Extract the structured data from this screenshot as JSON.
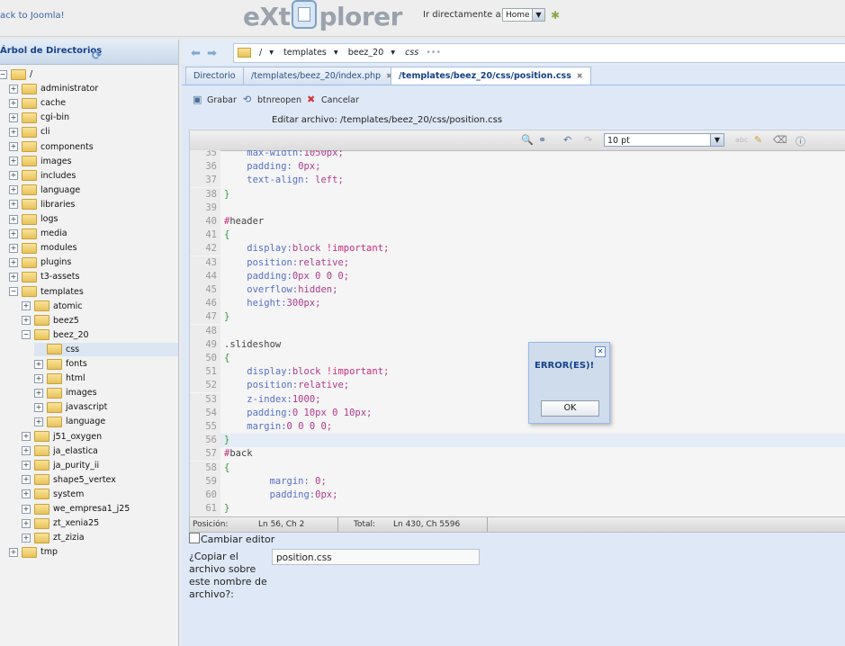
{
  "top": {
    "back_link": "ack to Joomla!",
    "logo_left": "eXt",
    "logo_right": "plorer",
    "goto_label": "Ir directamente a:",
    "goto_value": "Home"
  },
  "left": {
    "title": "Árbol de Directorios",
    "tree": [
      {
        "label": "/",
        "depth": 0,
        "open": true
      },
      {
        "label": "administrator",
        "depth": 1
      },
      {
        "label": "cache",
        "depth": 1
      },
      {
        "label": "cgi-bin",
        "depth": 1
      },
      {
        "label": "cli",
        "depth": 1
      },
      {
        "label": "components",
        "depth": 1
      },
      {
        "label": "images",
        "depth": 1
      },
      {
        "label": "includes",
        "depth": 1
      },
      {
        "label": "language",
        "depth": 1
      },
      {
        "label": "libraries",
        "depth": 1
      },
      {
        "label": "logs",
        "depth": 1
      },
      {
        "label": "media",
        "depth": 1
      },
      {
        "label": "modules",
        "depth": 1
      },
      {
        "label": "plugins",
        "depth": 1
      },
      {
        "label": "t3-assets",
        "depth": 1
      },
      {
        "label": "templates",
        "depth": 1,
        "open": true
      },
      {
        "label": "atomic",
        "depth": 2
      },
      {
        "label": "beez5",
        "depth": 2
      },
      {
        "label": "beez_20",
        "depth": 2,
        "open": true
      },
      {
        "label": "css",
        "depth": 3,
        "selected": true,
        "leaf": true
      },
      {
        "label": "fonts",
        "depth": 3
      },
      {
        "label": "html",
        "depth": 3
      },
      {
        "label": "images",
        "depth": 3
      },
      {
        "label": "javascript",
        "depth": 3
      },
      {
        "label": "language",
        "depth": 3
      },
      {
        "label": "j51_oxygen",
        "depth": 2
      },
      {
        "label": "ja_elastica",
        "depth": 2
      },
      {
        "label": "ja_purity_ii",
        "depth": 2
      },
      {
        "label": "shape5_vertex",
        "depth": 2
      },
      {
        "label": "system",
        "depth": 2
      },
      {
        "label": "we_empresa1_j25",
        "depth": 2
      },
      {
        "label": "zt_xenia25",
        "depth": 2
      },
      {
        "label": "zt_zizia",
        "depth": 2
      },
      {
        "label": "tmp",
        "depth": 1
      }
    ]
  },
  "path": {
    "root": "/",
    "p1": "templates",
    "p2": "beez_20",
    "p3": "css"
  },
  "tabs": [
    {
      "label": "Directorio"
    },
    {
      "label": "/templates/beez_20/index.php"
    },
    {
      "label": "/templates/beez_20/css/position.css"
    }
  ],
  "toolbar": {
    "save": "Grabar",
    "reopen": "btnreopen",
    "cancel": "Cancelar"
  },
  "edit_label": "Editar archivo: /templates/beez_20/css/position.css",
  "font_size": "10 pt",
  "code": [
    {
      "n": "35",
      "parts": [
        {
          "c": "prop",
          "t": "    max-width:"
        },
        {
          "c": "val",
          "t": "1050px;"
        }
      ]
    },
    {
      "n": "36",
      "parts": [
        {
          "c": "prop",
          "t": "    padding: "
        },
        {
          "c": "val",
          "t": "0px;"
        }
      ]
    },
    {
      "n": "37",
      "parts": [
        {
          "c": "prop",
          "t": "    text-align: "
        },
        {
          "c": "val",
          "t": "left;"
        }
      ]
    },
    {
      "n": "38",
      "parts": [
        {
          "c": "brace",
          "t": "}"
        }
      ]
    },
    {
      "n": "39",
      "parts": []
    },
    {
      "n": "40",
      "parts": [
        {
          "c": "imp",
          "t": "#"
        },
        {
          "c": "sel-name",
          "t": "header"
        }
      ]
    },
    {
      "n": "41",
      "parts": [
        {
          "c": "brace",
          "t": "{"
        }
      ]
    },
    {
      "n": "42",
      "parts": [
        {
          "c": "prop",
          "t": "    display:"
        },
        {
          "c": "val",
          "t": "block "
        },
        {
          "c": "imp",
          "t": "!important;"
        }
      ]
    },
    {
      "n": "43",
      "parts": [
        {
          "c": "prop",
          "t": "    position:"
        },
        {
          "c": "val",
          "t": "relative;"
        }
      ]
    },
    {
      "n": "44",
      "parts": [
        {
          "c": "prop",
          "t": "    padding:"
        },
        {
          "c": "val",
          "t": "0px 0 0 0;"
        }
      ]
    },
    {
      "n": "45",
      "parts": [
        {
          "c": "prop",
          "t": "    overflow:"
        },
        {
          "c": "val",
          "t": "hidden;"
        }
      ]
    },
    {
      "n": "46",
      "parts": [
        {
          "c": "prop",
          "t": "    height:"
        },
        {
          "c": "val",
          "t": "300px;"
        }
      ]
    },
    {
      "n": "47",
      "parts": [
        {
          "c": "brace",
          "t": "}"
        }
      ]
    },
    {
      "n": "48",
      "parts": []
    },
    {
      "n": "49",
      "parts": [
        {
          "c": "sel-name",
          "t": ".slideshow"
        }
      ]
    },
    {
      "n": "50",
      "parts": [
        {
          "c": "brace",
          "t": "{"
        }
      ]
    },
    {
      "n": "51",
      "parts": [
        {
          "c": "prop",
          "t": "    display:"
        },
        {
          "c": "val",
          "t": "block "
        },
        {
          "c": "imp",
          "t": "!important;"
        }
      ]
    },
    {
      "n": "52",
      "parts": [
        {
          "c": "prop",
          "t": "    position:"
        },
        {
          "c": "val",
          "t": "relative;"
        }
      ]
    },
    {
      "n": "53",
      "parts": [
        {
          "c": "prop",
          "t": "    z-index:"
        },
        {
          "c": "val",
          "t": "1000;"
        }
      ]
    },
    {
      "n": "54",
      "parts": [
        {
          "c": "prop",
          "t": "    padding:"
        },
        {
          "c": "val",
          "t": "0 10px 0 10px;"
        }
      ]
    },
    {
      "n": "55",
      "parts": [
        {
          "c": "prop",
          "t": "    margin:"
        },
        {
          "c": "val",
          "t": "0 0 0 0;"
        }
      ]
    },
    {
      "n": "56",
      "parts": [
        {
          "c": "brace",
          "t": "}"
        }
      ],
      "current": true
    },
    {
      "n": "57",
      "parts": [
        {
          "c": "imp",
          "t": "#"
        },
        {
          "c": "sel-name",
          "t": "back"
        }
      ]
    },
    {
      "n": "58",
      "parts": [
        {
          "c": "brace",
          "t": "{"
        }
      ]
    },
    {
      "n": "59",
      "parts": [
        {
          "c": "prop",
          "t": "        margin: "
        },
        {
          "c": "val",
          "t": "0;"
        }
      ]
    },
    {
      "n": "60",
      "parts": [
        {
          "c": "prop",
          "t": "        padding:"
        },
        {
          "c": "val",
          "t": "0px;"
        }
      ]
    },
    {
      "n": "61",
      "parts": [
        {
          "c": "brace",
          "t": "}"
        }
      ]
    }
  ],
  "status": {
    "pos_label": "Posición:",
    "pos_value": "Ln 56, Ch 2",
    "total_label": "Total:",
    "total_value": "Ln 430, Ch 5596"
  },
  "change_editor": "Cambiar editor",
  "copy_label": "¿Copiar el archivo sobre este nombre de archivo?:",
  "copy_value": "position.css",
  "dialog": {
    "title": "ERROR(ES)!",
    "ok": "OK"
  }
}
